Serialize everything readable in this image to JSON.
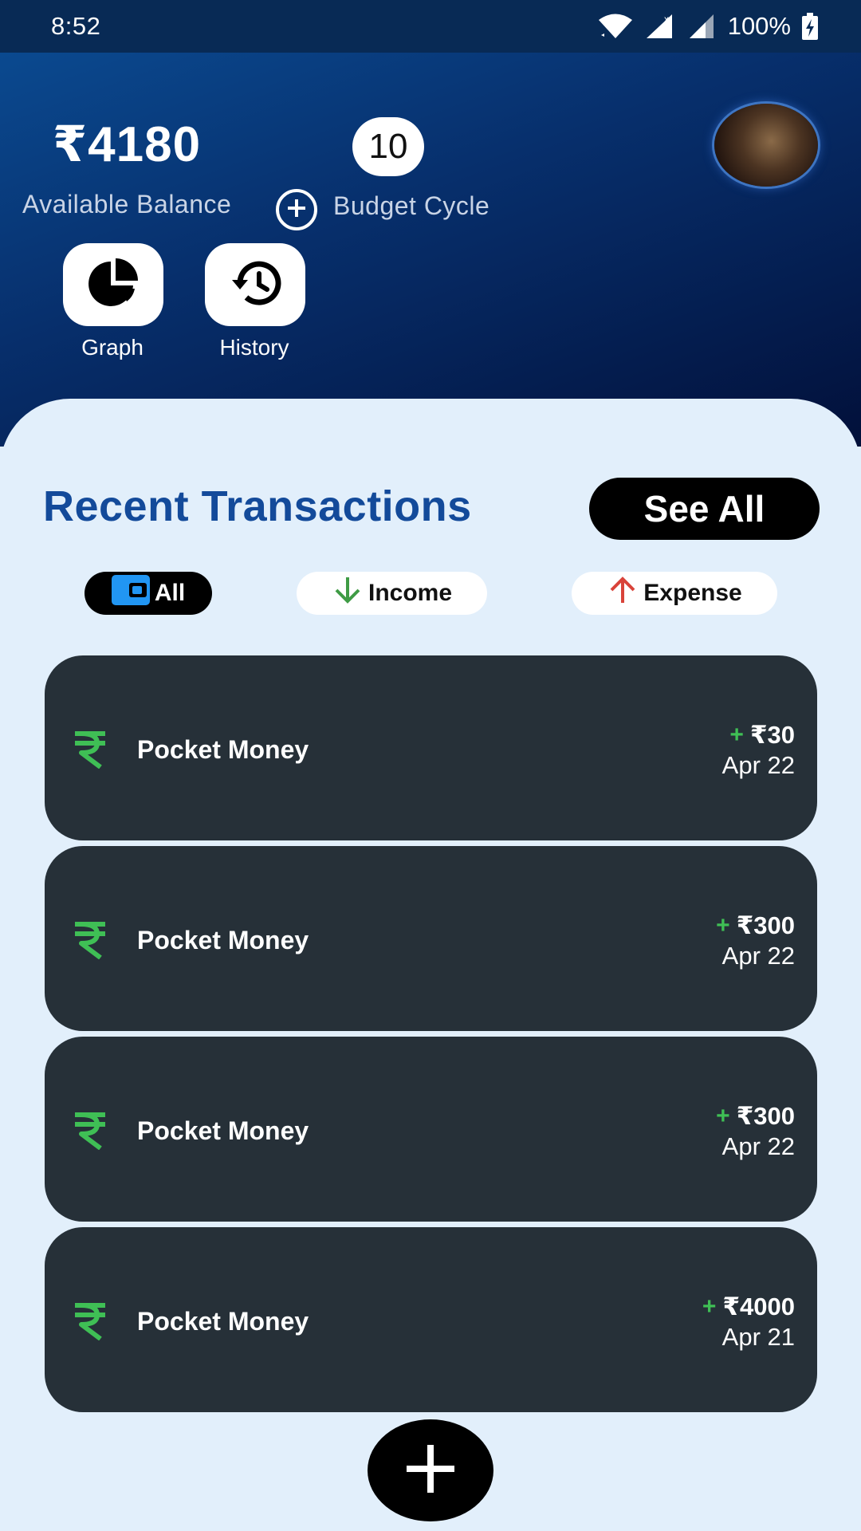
{
  "status_bar": {
    "time": "8:52",
    "battery": "100%"
  },
  "header": {
    "balance_amount": "₹4180",
    "balance_label": "Available Balance",
    "cycle_count": "10",
    "cycle_label": "Budget Cycle",
    "actions": [
      {
        "label": "Graph",
        "icon": "pie-chart-icon"
      },
      {
        "label": "History",
        "icon": "history-icon"
      }
    ]
  },
  "transactions_section": {
    "title": "Recent Transactions",
    "see_all_label": "See All",
    "filters": [
      {
        "label": "All",
        "icon": "wallet-icon",
        "selected": true
      },
      {
        "label": "Income",
        "icon": "arrow-down-icon",
        "color": "#3f9b45"
      },
      {
        "label": "Expense",
        "icon": "arrow-up-icon",
        "color": "#d9433a"
      }
    ],
    "items": [
      {
        "title": "Pocket Money",
        "sign": "+",
        "amount": "₹30",
        "date": "Apr 22",
        "icon": "rupee-icon"
      },
      {
        "title": "Pocket Money",
        "sign": "+",
        "amount": "₹300",
        "date": "Apr 22",
        "icon": "rupee-icon"
      },
      {
        "title": "Pocket Money",
        "sign": "+",
        "amount": "₹300",
        "date": "Apr 22",
        "icon": "rupee-icon"
      },
      {
        "title": "Pocket Money",
        "sign": "+",
        "amount": "₹4000",
        "date": "Apr 21",
        "icon": "rupee-icon"
      }
    ]
  },
  "fab": {
    "icon": "plus-icon"
  },
  "colors": {
    "header_top": "#0b4e96",
    "header_bottom": "#02103a",
    "sheet_bg": "#e2effb",
    "card_bg": "#263038",
    "title_blue": "#134a9a",
    "income_green": "#3fbf55"
  }
}
